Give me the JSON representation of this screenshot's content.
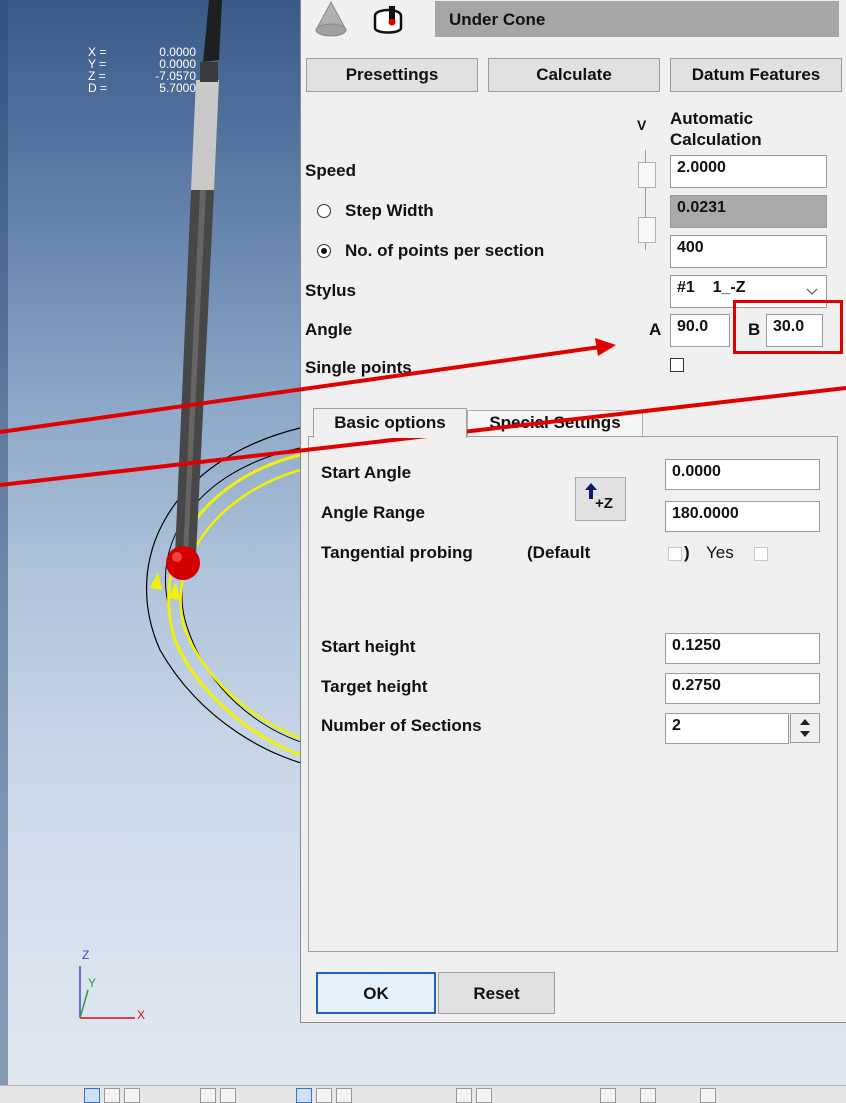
{
  "viewport": {
    "coords": [
      {
        "axis": "X =",
        "value": "0.0000"
      },
      {
        "axis": "Y =",
        "value": "0.0000"
      },
      {
        "axis": "Z =",
        "value": "-7.0570"
      },
      {
        "axis": "D =",
        "value": "5.7000"
      }
    ],
    "triad": {
      "z": "Z",
      "y": "Y",
      "x": "X"
    }
  },
  "dialog": {
    "title": "Under Cone",
    "buttons": {
      "presettings": "Presettings",
      "calculate": "Calculate",
      "datum": "Datum Features"
    },
    "v_label": "V",
    "auto_calc": "Automatic Calculation",
    "speed": {
      "label": "Speed",
      "value": "2.0000"
    },
    "step_width": {
      "label": "Step Width",
      "value": "0.0231",
      "selected": false
    },
    "points_per_section": {
      "label": "No. of points per section",
      "value": "400",
      "selected": true
    },
    "stylus": {
      "label": "Stylus",
      "value": "#1    1_-Z"
    },
    "angle": {
      "label": "Angle",
      "a_label": "A",
      "a_value": "90.0",
      "b_label": "B",
      "b_value": "30.0"
    },
    "single_points": {
      "label": "Single points",
      "checked": false
    },
    "tabs": [
      "Basic options",
      "Special Settings"
    ],
    "basic": {
      "start_angle": {
        "label": "Start Angle",
        "value": "0.0000"
      },
      "angle_range": {
        "label": "Angle Range",
        "value": "180.0000"
      },
      "direction_button": "+Z",
      "tangential": {
        "label": "Tangential probing",
        "default_label": "(Default",
        "yes_label": "Yes"
      },
      "start_height": {
        "label": "Start height",
        "value": "0.1250"
      },
      "target_height": {
        "label": "Target height",
        "value": "0.2750"
      },
      "sections": {
        "label": "Number of Sections",
        "value": "2"
      }
    },
    "ok": "OK",
    "reset": "Reset"
  },
  "colors": {
    "annotation_red": "#e00000",
    "path_yellow": "#f2f200",
    "probe_ball": "#d40000"
  }
}
